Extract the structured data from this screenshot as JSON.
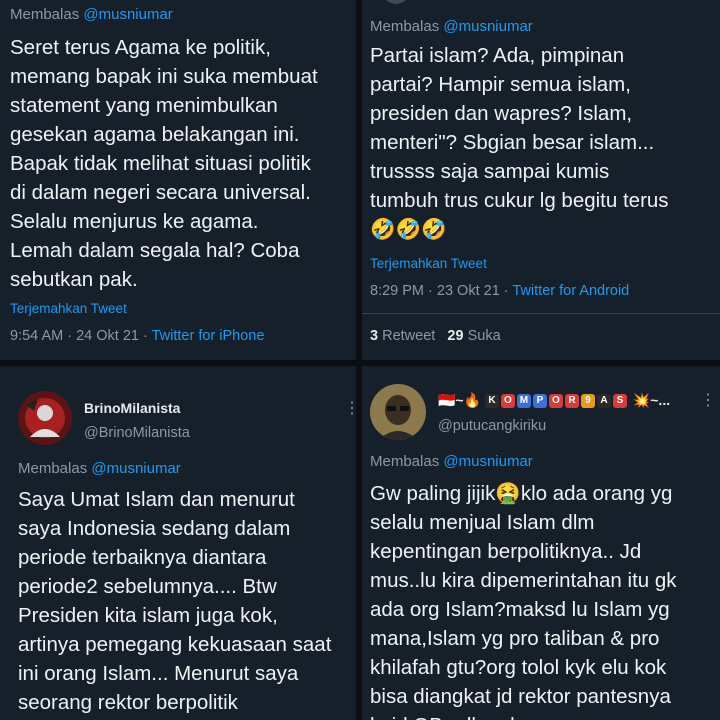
{
  "tweets": [
    {
      "reply_prefix": "Membalas",
      "reply_handle": "@musniumar",
      "body": "Seret terus Agama ke politik,\nmemang bapak ini suka membuat\nstatement yang menimbulkan\ngesekan agama belakangan ini.\nBapak tidak melihat situasi politik\ndi dalam negeri secara universal.\nSelalu menjurus ke agama.\nLemah dalam segala hal? Coba\nsebutkan pak.",
      "translate": "Terjemahkan Tweet",
      "time": "9:54 AM · 24 Okt 21 · ",
      "source": "Twitter for iPhone"
    },
    {
      "reply_prefix": "Membalas",
      "reply_handle": "@musniumar",
      "body": "Partai islam? Ada, pimpinan\npartai? Hampir semua islam,\npresiden dan wapres? Islam,\nmenteri\"? Sbgian besar islam...\ntrussss saja sampai kumis\ntumbuh trus cukur lg begitu terus\n🤣🤣🤣",
      "translate": "Terjemahkan Tweet",
      "time": "8:29 PM · 23 Okt 21 · ",
      "source": "Twitter for Android",
      "retweets": "3",
      "retweet_label": "Retweet",
      "likes": "29",
      "likes_label": "Suka"
    },
    {
      "name": "BrinoMilanista",
      "handle": "@BrinoMilanista",
      "reply_prefix": "Membalas",
      "reply_handle": "@musniumar",
      "body": "Saya Umat Islam dan menurut\nsaya Indonesia sedang dalam\nperiode terbaiknya diantara\nperiode2 sebelumnya.... Btw\nPresiden kita islam juga kok,\nartinya pemegang kekuasaan saat\nini orang Islam... Menurut saya\nseorang rektor berpolitik\njamur dalam...? Organtidak adal"
    },
    {
      "name_prefix": "🇮🇩~🔥",
      "name_letters": [
        "K",
        "O",
        "M",
        "P",
        "O",
        "R",
        "9",
        "A",
        "S"
      ],
      "name_suffix": "💥~...",
      "handle": "@putucangkiriku",
      "reply_prefix": "Membalas",
      "reply_handle": "@musniumar",
      "body": "Gw paling jijik🤮klo ada orang yg\nselalu menjual Islam dlm\nkepentingan berpolitiknya.. Jd\nmus..lu kira dipemerintahan itu gk\nada org Islam?maksd lu Islam yg\nmana,Islam yg pro taliban & pro\nkhilafah gtu?org tolol kyk elu kok\nbisa diangkat jd rektor pantesnya\nlu jd OB udh cakep"
    }
  ],
  "colors": {
    "accent": "#1d9bf0",
    "background": "#15202b",
    "muted": "#8b98a5"
  }
}
